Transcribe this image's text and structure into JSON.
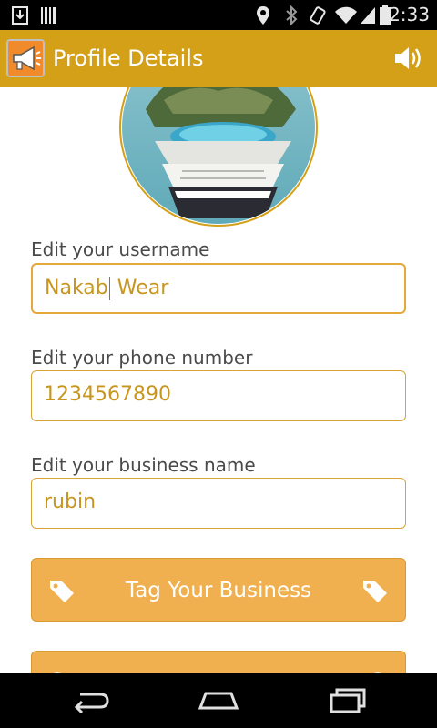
{
  "status_bar": {
    "time": "2:33",
    "icons": [
      "download-icon",
      "barcode-icon",
      "location-icon",
      "bluetooth-icon",
      "vibrate-icon",
      "wifi-icon",
      "signal-icon",
      "battery-icon"
    ]
  },
  "action_bar": {
    "title": "Profile Details",
    "app_icon": "megaphone-icon",
    "right_icon": "speaker-icon",
    "background": "#d4a017"
  },
  "form": {
    "username": {
      "label": "Edit your username",
      "value_start": "Nakab",
      "value_end": " Wear"
    },
    "phone": {
      "label": "Edit your phone number",
      "value": "1234567890"
    },
    "business": {
      "label": "Edit your business name",
      "value": "rubin"
    }
  },
  "buttons": {
    "tag_business": {
      "label": "Tag Your Business",
      "icon": "tag-icon"
    }
  },
  "colors": {
    "accent": "#f0b04f",
    "field_text": "#c8961e",
    "field_border": "#d7a536"
  },
  "nav_bar": {
    "icons": [
      "back-icon",
      "home-icon",
      "recents-icon"
    ]
  }
}
